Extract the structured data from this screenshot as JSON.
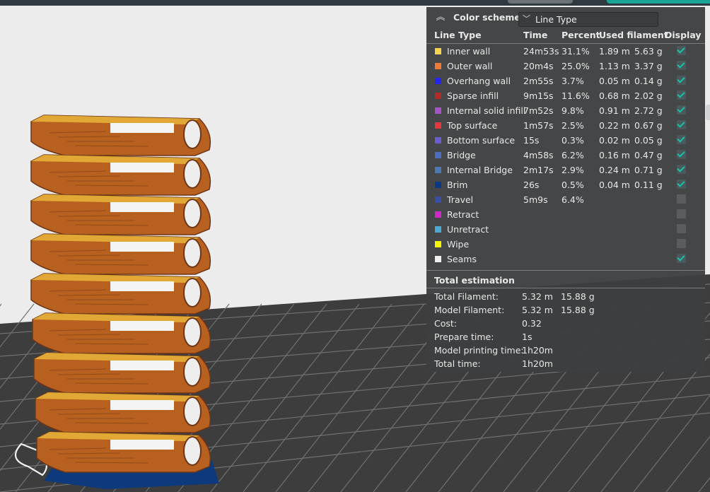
{
  "colors": {
    "background": "#ececec",
    "bed": "#3d3d3d",
    "bed_grid": "#6d6d6d",
    "model_orange": "#b8601f",
    "model_dark": "#6e3518",
    "model_yellow": "#e7b53a",
    "accent": "#19c0a8"
  },
  "legend": {
    "color_scheme_label": "Color scheme",
    "color_scheme_value": "Line Type",
    "collapse_icon": "collapse-up-icon",
    "headers": {
      "line_type": "Line Type",
      "time": "Time",
      "percent": "Percent",
      "used_filament": "Used filament",
      "display": "Display"
    },
    "rows": [
      {
        "label": "Inner wall",
        "color": "#f6d34f",
        "time": "24m53s",
        "percent": "31.1%",
        "length": "1.89 m",
        "weight": "5.63 g",
        "display": true
      },
      {
        "label": "Outer wall",
        "color": "#ef7a35",
        "time": "20m4s",
        "percent": "25.0%",
        "length": "1.13 m",
        "weight": "3.37 g",
        "display": true
      },
      {
        "label": "Overhang wall",
        "color": "#2626ef",
        "time": "2m55s",
        "percent": "3.7%",
        "length": "0.05 m",
        "weight": "0.14 g",
        "display": true
      },
      {
        "label": "Sparse infill",
        "color": "#b22a2a",
        "time": "9m15s",
        "percent": "11.6%",
        "length": "0.68 m",
        "weight": "2.02 g",
        "display": true
      },
      {
        "label": "Internal solid infill",
        "color": "#a452c4",
        "time": "7m52s",
        "percent": "9.8%",
        "length": "0.91 m",
        "weight": "2.72 g",
        "display": true
      },
      {
        "label": "Top surface",
        "color": "#e5373e",
        "time": "1m57s",
        "percent": "2.5%",
        "length": "0.22 m",
        "weight": "0.67 g",
        "display": true
      },
      {
        "label": "Bottom surface",
        "color": "#6a5ecf",
        "time": "15s",
        "percent": "0.3%",
        "length": "0.02 m",
        "weight": "0.05 g",
        "display": true
      },
      {
        "label": "Bridge",
        "color": "#4d6ec0",
        "time": "4m58s",
        "percent": "6.2%",
        "length": "0.16 m",
        "weight": "0.47 g",
        "display": true
      },
      {
        "label": "Internal Bridge",
        "color": "#4c78b3",
        "time": "2m17s",
        "percent": "2.9%",
        "length": "0.24 m",
        "weight": "0.71 g",
        "display": true
      },
      {
        "label": "Brim",
        "color": "#0b3a85",
        "time": "26s",
        "percent": "0.5%",
        "length": "0.04 m",
        "weight": "0.11 g",
        "display": true
      },
      {
        "label": "Travel",
        "color": "#3b4da5",
        "time": "5m9s",
        "percent": "6.4%",
        "length": "",
        "weight": "",
        "display": false
      },
      {
        "label": "Retract",
        "color": "#cf28c9",
        "time": "",
        "percent": "",
        "length": "",
        "weight": "",
        "display": false
      },
      {
        "label": "Unretract",
        "color": "#4aa8d4",
        "time": "",
        "percent": "",
        "length": "",
        "weight": "",
        "display": false
      },
      {
        "label": "Wipe",
        "color": "#f5f500",
        "time": "",
        "percent": "",
        "length": "",
        "weight": "",
        "display": false
      },
      {
        "label": "Seams",
        "color": "#efefef",
        "time": "",
        "percent": "",
        "length": "",
        "weight": "",
        "display": true
      }
    ],
    "total_title": "Total estimation",
    "totals": [
      {
        "label": "Total Filament:",
        "v1": "5.32 m",
        "v2": "15.88 g"
      },
      {
        "label": "Model Filament:",
        "v1": "5.32 m",
        "v2": "15.88 g"
      },
      {
        "label": "Cost:",
        "v1": "0.32",
        "v2": ""
      },
      {
        "label": "Prepare time:",
        "v1": "1s",
        "v2": ""
      },
      {
        "label": "Model printing time:",
        "v1": "1h20m",
        "v2": ""
      },
      {
        "label": "Total time:",
        "v1": "1h20m",
        "v2": ""
      }
    ]
  }
}
